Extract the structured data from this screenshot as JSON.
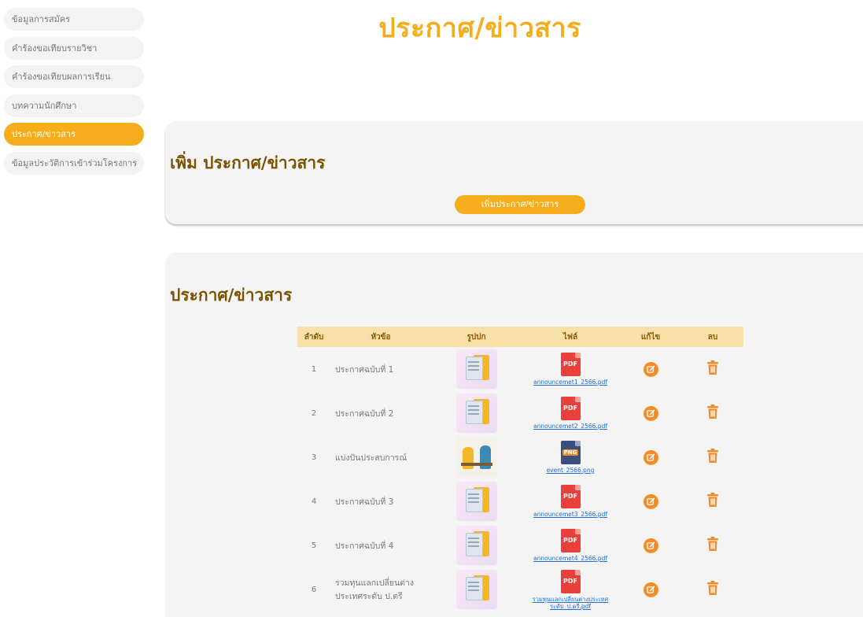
{
  "sidebar": {
    "items": [
      {
        "label": "ข้อมูลการสมัคร",
        "active": false
      },
      {
        "label": "คำร้องขอเทียบรายวิชา",
        "active": false
      },
      {
        "label": "คำร้องขอเทียบผลการเรียน",
        "active": false
      },
      {
        "label": "บทความนักศึกษา",
        "active": false
      },
      {
        "label": "ประกาศ/ข่าวสาร",
        "active": true
      },
      {
        "label": "ข้อมูลประวัติการเข้าร่วมโครงการ",
        "active": false
      }
    ]
  },
  "page": {
    "title": "ประกาศ/ข่าวสาร"
  },
  "add_section": {
    "heading": "เพิ่ม ประกาศ/ข่าวสาร",
    "button_label": "เพิ่มประกาศ/ข่าวสาร"
  },
  "list_section": {
    "heading": "ประกาศ/ข่าวสาร",
    "columns": [
      "ลำดับ",
      "หัวข้อ",
      "รูปปก",
      "ไฟล์",
      "แก้ไข",
      "ลบ"
    ],
    "rows": [
      {
        "no": "1",
        "topic": "ประกาศฉบับที่ 1",
        "file_type": "PDF",
        "file_name": "announcemet1_2566.pdf"
      },
      {
        "no": "2",
        "topic": "ประกาศฉบับที่ 2",
        "file_type": "PDF",
        "file_name": "announcemet2_2566.pdf"
      },
      {
        "no": "3",
        "topic": "แบ่งปันประสบการณ์",
        "file_type": "PNG",
        "file_name": "event_2566.png"
      },
      {
        "no": "4",
        "topic": "ประกาศฉบับที่ 3",
        "file_type": "PDF",
        "file_name": "announcemet3_2566.pdf"
      },
      {
        "no": "5",
        "topic": "ประกาศฉบับที่ 4",
        "file_type": "PDF",
        "file_name": "announcemet4_2566.pdf"
      },
      {
        "no": "6",
        "topic": "รวมทุนแลกเปลี่ยนต่างประเทศระดับ ป.ตรี",
        "file_type": "PDF",
        "file_name": "รวมทุนแลกเปลี่ยนต่างประเทศระดับ_ป.ตรี.pdf"
      }
    ]
  },
  "colors": {
    "accent": "#f5ad1c",
    "heading": "#7a5200",
    "table_header": "#f8e1a8",
    "edit": "#f28c28",
    "delete": "#f28c28",
    "pdf": "#e8403a",
    "link": "#1d6fe0"
  },
  "icons": {
    "cover": "document-cover-image",
    "edit": "edit-icon",
    "delete": "trash-icon",
    "pdf": "pdf-file-icon",
    "png": "png-file-icon"
  }
}
